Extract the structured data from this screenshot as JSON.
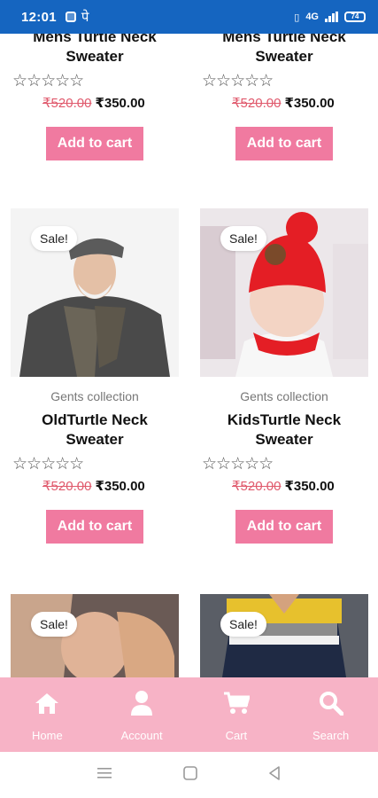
{
  "status_bar": {
    "time": "12:01",
    "carrier_glyph": "पे",
    "network": "4G",
    "battery": "74"
  },
  "products": [
    {
      "title": "Mens Turtle Neck Sweater",
      "category": "",
      "old_price": "₹520.00",
      "new_price": "₹350.00",
      "sale": "",
      "button": "Add to cart",
      "rating": "☆☆☆☆☆"
    },
    {
      "title": "Mens Turtle Neck Sweater",
      "category": "",
      "old_price": "₹520.00",
      "new_price": "₹350.00",
      "sale": "",
      "button": "Add to cart",
      "rating": "☆☆☆☆☆"
    },
    {
      "title": "OldTurtle Neck Sweater",
      "category": "Gents collection",
      "old_price": "₹520.00",
      "new_price": "₹350.00",
      "sale": "Sale!",
      "button": "Add to cart",
      "rating": "☆☆☆☆☆"
    },
    {
      "title": "KidsTurtle Neck Sweater",
      "category": "Gents collection",
      "old_price": "₹520.00",
      "new_price": "₹350.00",
      "sale": "Sale!",
      "button": "Add to cart",
      "rating": "☆☆☆☆☆"
    },
    {
      "sale": "Sale!"
    },
    {
      "sale": "Sale!"
    }
  ],
  "bottom_nav": [
    {
      "label": "Home",
      "icon": "home-icon"
    },
    {
      "label": "Account",
      "icon": "account-icon"
    },
    {
      "label": "Cart",
      "icon": "cart-icon"
    },
    {
      "label": "Search",
      "icon": "search-icon"
    }
  ],
  "colors": {
    "status_bar": "#1565c0",
    "accent": "#f07aa0",
    "nav_bg": "#f7b3c6",
    "old_price": "#e05a6d"
  }
}
